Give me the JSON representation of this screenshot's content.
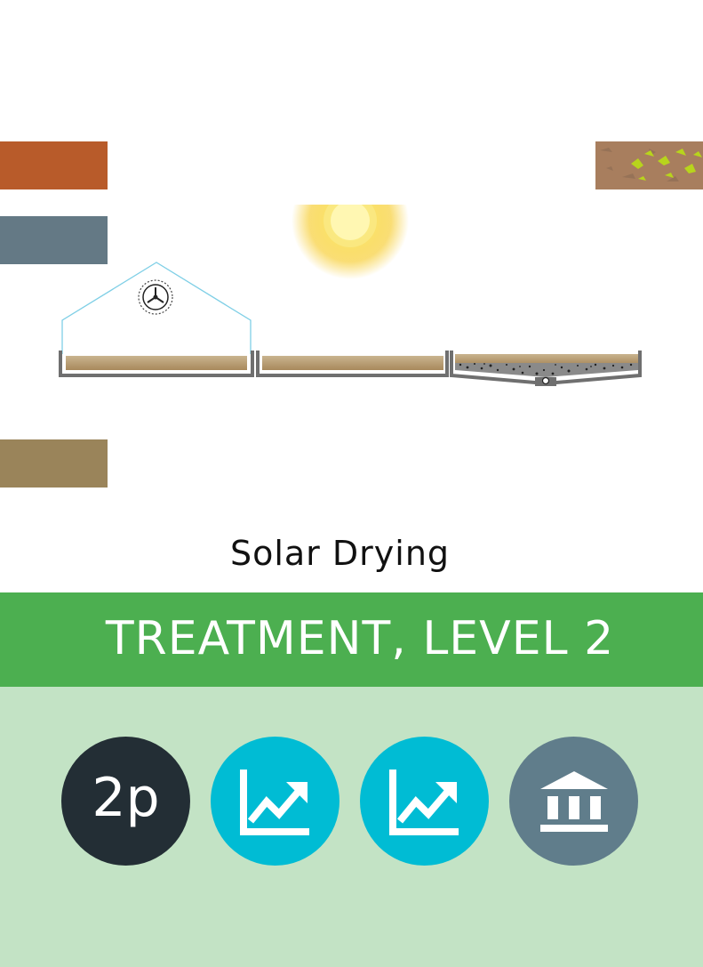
{
  "title": "Solar Drying",
  "category_label": "TREATMENT, LEVEL 2",
  "colors": {
    "swatch_orange": "#b85b2a",
    "swatch_slate": "#647985",
    "swatch_brown": "#9a845a",
    "banner_green": "#4caf50",
    "lower_panel": "#c3e3c5",
    "badge_dark": "#232e35",
    "badge_cyan": "#00bcd4",
    "badge_gray": "#607d8b",
    "sludge": "#b39870"
  },
  "badges": [
    {
      "kind": "text",
      "text": "2p",
      "icon": ""
    },
    {
      "kind": "icon",
      "text": "",
      "icon": "trending-up-chart-icon"
    },
    {
      "kind": "icon",
      "text": "",
      "icon": "trending-up-chart-icon"
    },
    {
      "kind": "icon",
      "text": "",
      "icon": "institution-building-icon"
    }
  ]
}
